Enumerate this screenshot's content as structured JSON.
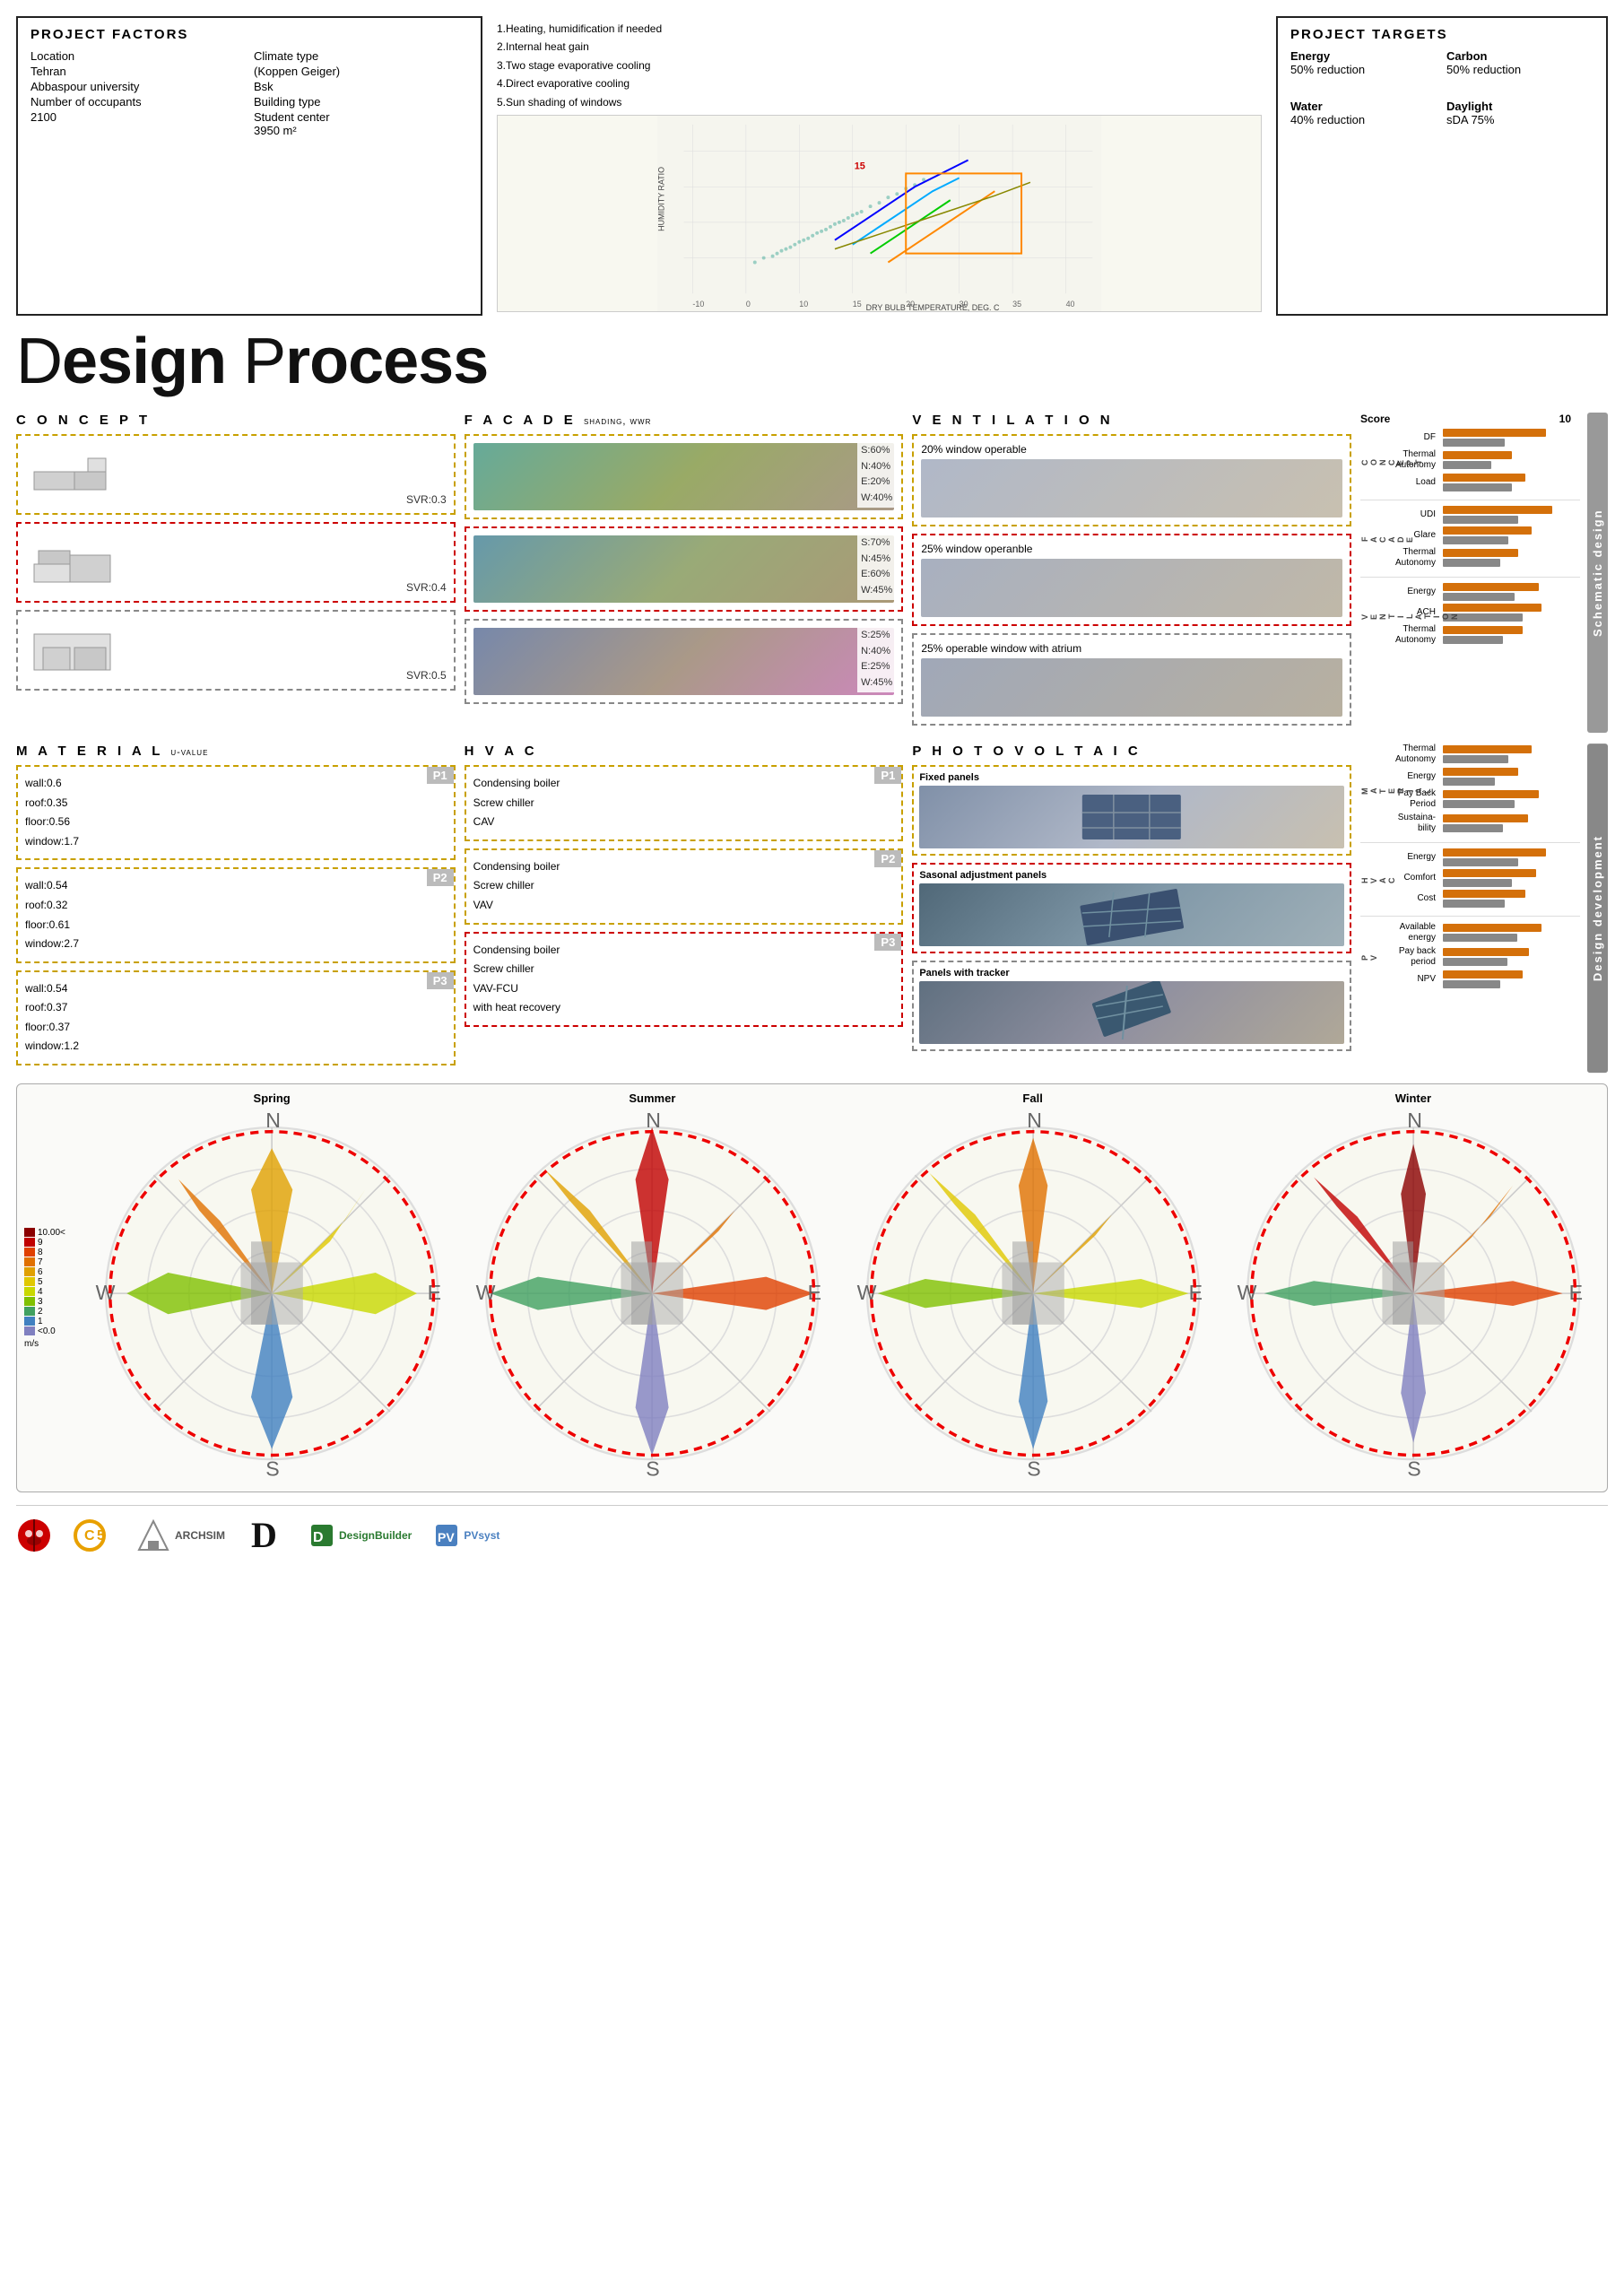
{
  "page": {
    "title": "Design Process"
  },
  "project_factors": {
    "title": "Project Factors",
    "location_label": "Location",
    "location_val": "Tehran",
    "sub_location": "Abbaspour university",
    "climate_label": "Climate type",
    "climate_val": "(Koppen Geiger)",
    "climate_code": "Bsk",
    "occupants_label": "Number of occupants",
    "occupants_val": "2100",
    "building_type_label": "Building type",
    "building_type_val": "Student center",
    "building_area": "3950 m²",
    "strategies": [
      "1.Heating, humidification if needed",
      "2.Internal heat gain",
      "3.Two stage evaporative cooling",
      "4.Direct evaporative cooling",
      "5.Sun shading of windows"
    ]
  },
  "project_targets": {
    "title": "Project Targets",
    "items": [
      {
        "category": "Energy",
        "value": "50% reduction"
      },
      {
        "category": "Carbon",
        "value": "50% reduction"
      },
      {
        "category": "Water",
        "value": "40% reduction"
      },
      {
        "category": "Daylight",
        "value": "sDA 75%"
      }
    ]
  },
  "design_process_title": "Design Process",
  "sections": {
    "concept": {
      "title": "Concept",
      "boxes": [
        {
          "svr": "SVR:0.3",
          "border": "yellow"
        },
        {
          "svr": "SVR:0.4",
          "border": "red"
        },
        {
          "svr": "SVR:0.5",
          "border": "gray"
        }
      ]
    },
    "facade": {
      "title": "Facade",
      "subtitle": "shading, wwr",
      "boxes": [
        {
          "params": "S:60%\nN:40%\nE:20%\nW:40%",
          "border": "yellow"
        },
        {
          "params": "S:70%\nN:45%\nE:60%\nW:45%",
          "border": "red"
        },
        {
          "params": "S:25%\nN:40%\nE:25%\nW:45%",
          "border": "gray"
        }
      ]
    },
    "ventilation": {
      "title": "Ventilation",
      "boxes": [
        {
          "label": "20% window operable",
          "border": "yellow"
        },
        {
          "label": "25% window operanble",
          "border": "red"
        },
        {
          "label": "25% operable window with atrium",
          "border": "gray"
        }
      ]
    }
  },
  "scores_schematic": {
    "header": {
      "label": "Score",
      "max": "10"
    },
    "groups": [
      {
        "group": "CONCEPT",
        "rows": [
          {
            "label": "DF",
            "orange": 75,
            "gray": 45
          },
          {
            "label": "Thermal\nAutonomy",
            "orange": 50,
            "gray": 35
          },
          {
            "label": "Load",
            "orange": 60,
            "gray": 50
          }
        ]
      },
      {
        "group": "FACADE",
        "rows": [
          {
            "label": "UDI",
            "orange": 80,
            "gray": 55
          },
          {
            "label": "Glare",
            "orange": 65,
            "gray": 48
          },
          {
            "label": "Thermal\nAutonomy",
            "orange": 55,
            "gray": 42
          }
        ]
      },
      {
        "group": "VENTILATION",
        "rows": [
          {
            "label": "Energy",
            "orange": 70,
            "gray": 52
          },
          {
            "label": "ACH",
            "orange": 72,
            "gray": 58
          },
          {
            "label": "Thermal\nAutonomy",
            "orange": 58,
            "gray": 44
          }
        ]
      }
    ],
    "section_label": "Schematic design"
  },
  "material": {
    "title": "Material",
    "subtitle": "u-value",
    "boxes": [
      {
        "id": "P1",
        "vals": "wall:0.6\nroof:0.35\nfloor:0.56\nwindow:1.7"
      },
      {
        "id": "P2",
        "vals": "wall:0.54\nroof:0.32\nfloor:0.61\nwindow:2.7"
      },
      {
        "id": "P3",
        "vals": "wall:0.54\nroof:0.37\nfloor:0.37\nwindow:1.2"
      }
    ]
  },
  "hvac": {
    "title": "HVAC",
    "boxes": [
      {
        "id": "P1",
        "text": "Condensing boiler\nScrew chiller\nCAV"
      },
      {
        "id": "P2",
        "text": "Condensing boiler\nScrew chiller\nVAV"
      },
      {
        "id": "P3",
        "text": "Condensing boiler\nScrew chiller\nVAV-FCU\nwith heat recovery"
      }
    ]
  },
  "photovoltaic": {
    "title": "Photovoltaic",
    "boxes": [
      {
        "label": "Fixed panels",
        "border": "yellow"
      },
      {
        "label": "Sasonal adjustment panels",
        "border": "red"
      },
      {
        "label": "Panels with tracker",
        "border": "gray"
      }
    ]
  },
  "scores_dev": {
    "groups": [
      {
        "group": "M\nA\nT\nE\nR\nI\nA\nL",
        "rows": [
          {
            "label": "Thermal\nAutonomy",
            "orange": 65,
            "gray": 48
          },
          {
            "label": "Energy",
            "orange": 55,
            "gray": 38
          },
          {
            "label": "Pay Back\nPeriod",
            "orange": 70,
            "gray": 52
          },
          {
            "label": "Sustaina-\nbility",
            "orange": 62,
            "gray": 44
          }
        ]
      },
      {
        "group": "H\nV\nA\nC",
        "rows": [
          {
            "label": "Energy",
            "orange": 75,
            "gray": 55
          },
          {
            "label": "Comfort",
            "orange": 68,
            "gray": 50
          },
          {
            "label": "Cost",
            "orange": 60,
            "gray": 45
          }
        ]
      },
      {
        "group": "P\nV",
        "rows": [
          {
            "label": "Available\nenergy",
            "orange": 72,
            "gray": 54
          },
          {
            "label": "Pay back\nperiod",
            "orange": 63,
            "gray": 47
          },
          {
            "label": "NPV",
            "orange": 58,
            "gray": 42
          }
        ]
      }
    ],
    "section_label": "Design development"
  },
  "wind_rose": {
    "seasons": [
      "Spring",
      "Summer",
      "Fall",
      "Winter"
    ],
    "legend": [
      {
        "label": "10.00<",
        "color": "#8B0000"
      },
      {
        "label": "9",
        "color": "#c00000"
      },
      {
        "label": "8",
        "color": "#e04000"
      },
      {
        "label": "7",
        "color": "#e07000"
      },
      {
        "label": "6",
        "color": "#e0a000"
      },
      {
        "label": "5",
        "color": "#e0c800"
      },
      {
        "label": "4",
        "color": "#c8d800"
      },
      {
        "label": "3",
        "color": "#80c000"
      },
      {
        "label": "2",
        "color": "#40a060"
      },
      {
        "label": "1",
        "color": "#4080c0"
      },
      {
        "label": "<0.0",
        "color": "#8080c0"
      }
    ],
    "unit": "m/s"
  },
  "logos": [
    "Ladybug Tools",
    "C5",
    "ARCHSIM",
    "D",
    "DesignBuilder",
    "PVsyst"
  ]
}
